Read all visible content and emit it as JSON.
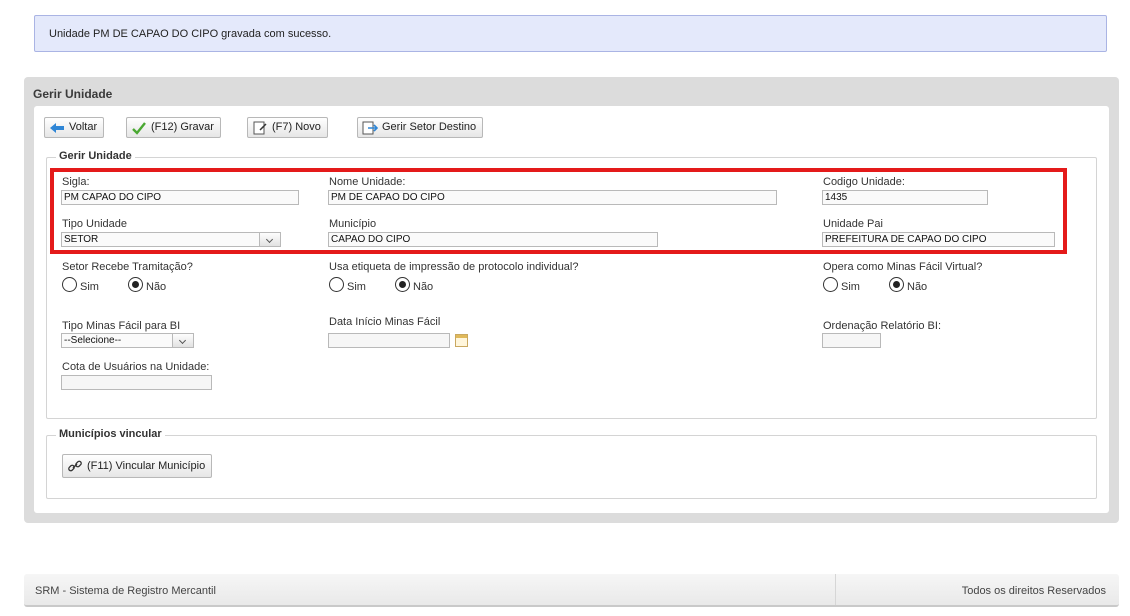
{
  "message": "Unidade PM DE CAPAO DO CIPO gravada com sucesso.",
  "panel": {
    "title": "Gerir Unidade"
  },
  "toolbar": {
    "voltar": "Voltar",
    "gravar": "(F12) Gravar",
    "novo": "(F7) Novo",
    "gerir_setor": "Gerir Setor Destino"
  },
  "form": {
    "legend": "Gerir Unidade",
    "sigla_label": "Sigla:",
    "sigla_value": "PM CAPAO DO CIPO",
    "nome_label": "Nome Unidade:",
    "nome_value": "PM DE CAPAO DO CIPO",
    "codigo_label": "Codigo Unidade:",
    "codigo_value": "1435",
    "tipo_label": "Tipo Unidade",
    "tipo_value": "SETOR",
    "municipio_label": "Município",
    "municipio_value": "CAPAO DO CIPO",
    "pai_label": "Unidade Pai",
    "pai_value": "PREFEITURA DE CAPAO DO CIPO",
    "setor_tramitacao_label": "Setor Recebe Tramitação?",
    "etiqueta_label": "Usa etiqueta de impressão de protocolo individual?",
    "minas_virtual_label": "Opera como Minas Fácil Virtual?",
    "sim": "Sim",
    "nao": "Não",
    "tipo_minas_label": "Tipo Minas Fácil para BI",
    "tipo_minas_value": "--Selecione--",
    "data_inicio_label": "Data Início Minas Fácil",
    "ordenacao_label": "Ordenação Relatório BI:",
    "cota_label": "Cota de Usuários na Unidade:"
  },
  "municipios": {
    "legend": "Municípios vincular",
    "vincular_button": "(F11) Vincular Município"
  },
  "footer": {
    "left": "SRM - Sistema de Registro Mercantil",
    "right": "Todos os direitos Reservados"
  },
  "colors": {
    "highlight": "#e41a1a",
    "message_bg": "#e4e9fb",
    "panel_bg": "#dcdcdc"
  }
}
